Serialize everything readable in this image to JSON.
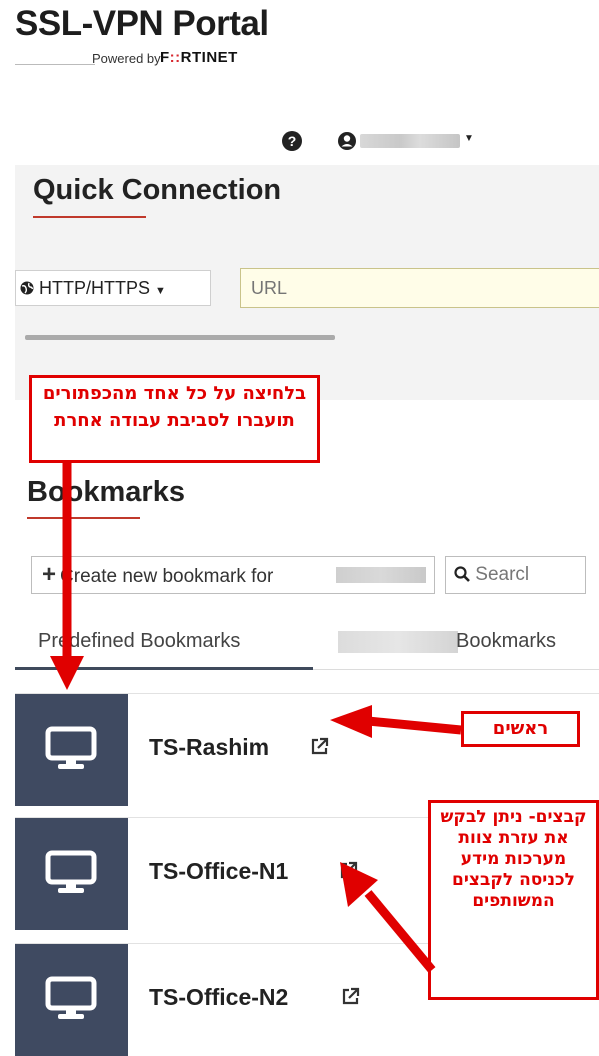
{
  "header": {
    "title": "SSL-VPN Portal",
    "powered_by": "Powered by",
    "vendor_prefix": "F",
    "vendor_mid": "::",
    "vendor_rest": "RTINET",
    "user_name": ""
  },
  "quick_connection": {
    "title": "Quick Connection",
    "protocol": "HTTP/HTTPS",
    "url_placeholder": "URL"
  },
  "bookmarks": {
    "title": "Bookmarks",
    "create_label": "Create new bookmark for",
    "search_placeholder": "Searcl",
    "tabs": [
      {
        "label": "Predefined Bookmarks",
        "active": true
      },
      {
        "label": "Bookmarks",
        "active": false
      }
    ],
    "items": [
      {
        "name": "TS-Rashim"
      },
      {
        "name": "TS-Office-N1"
      },
      {
        "name": "TS-Office-N2"
      }
    ]
  },
  "annotations": {
    "note1": "בלחיצה על כל אחד מהכפתורים תועברו לסביבת עבודה אחרת",
    "note2": "ראשים",
    "note3": "קבצים- ניתן לבקש את עזרת צוות מערכות מידע לכניסה לקבצים המשותפים"
  },
  "colors": {
    "accent_red": "#c0392b",
    "annotation_red": "#e00000",
    "tile_navy": "#3f4a61",
    "url_bg": "#fffde8"
  }
}
